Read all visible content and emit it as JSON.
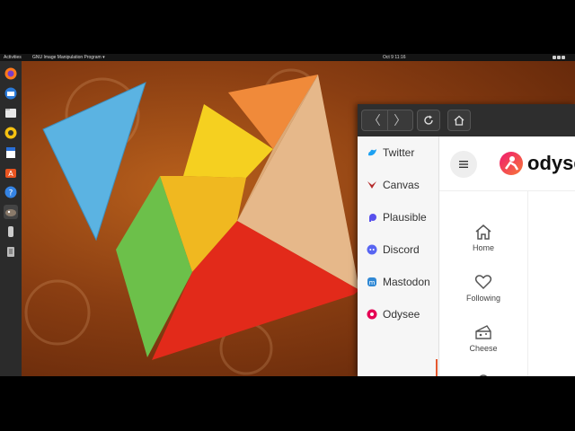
{
  "topbar": {
    "activities": "Activities",
    "app_menu": "GNU Image Manipulation Program ▾",
    "clock": "Oct 9  11:16"
  },
  "dock": {
    "items": [
      "firefox-icon",
      "thunderbird-icon",
      "files-icon",
      "rhythmbox-icon",
      "libreoffice-writer-icon",
      "software-center-icon",
      "help-icon",
      "gimp-icon",
      "usb-drive-icon",
      "trash-icon"
    ]
  },
  "browser": {
    "toolbar": {
      "back": "〈",
      "forward": "〉"
    },
    "sidebar": {
      "items": [
        {
          "label": "Twitter",
          "icon": "twitter-icon",
          "color": "#1da1f2"
        },
        {
          "label": "Canvas",
          "icon": "canvas-icon",
          "color": "#b52a2a"
        },
        {
          "label": "Plausible",
          "icon": "plausible-icon",
          "color": "#5850ec"
        },
        {
          "label": "Discord",
          "icon": "discord-icon",
          "color": "#5865f2"
        },
        {
          "label": "Mastodon",
          "icon": "mastodon-icon",
          "color": "#3088d4"
        },
        {
          "label": "Odysee",
          "icon": "odysee-icon",
          "color": "#e50054"
        }
      ],
      "active_index": 5
    },
    "odysee": {
      "logo_text": "odysee",
      "nav": [
        {
          "label": "Home",
          "icon": "home-icon"
        },
        {
          "label": "Following",
          "icon": "heart-icon"
        },
        {
          "label": "Cheese",
          "icon": "cheese-icon"
        }
      ]
    }
  },
  "colors": {
    "accent": "#e4572e",
    "toolbar": "#2e2e2e"
  }
}
